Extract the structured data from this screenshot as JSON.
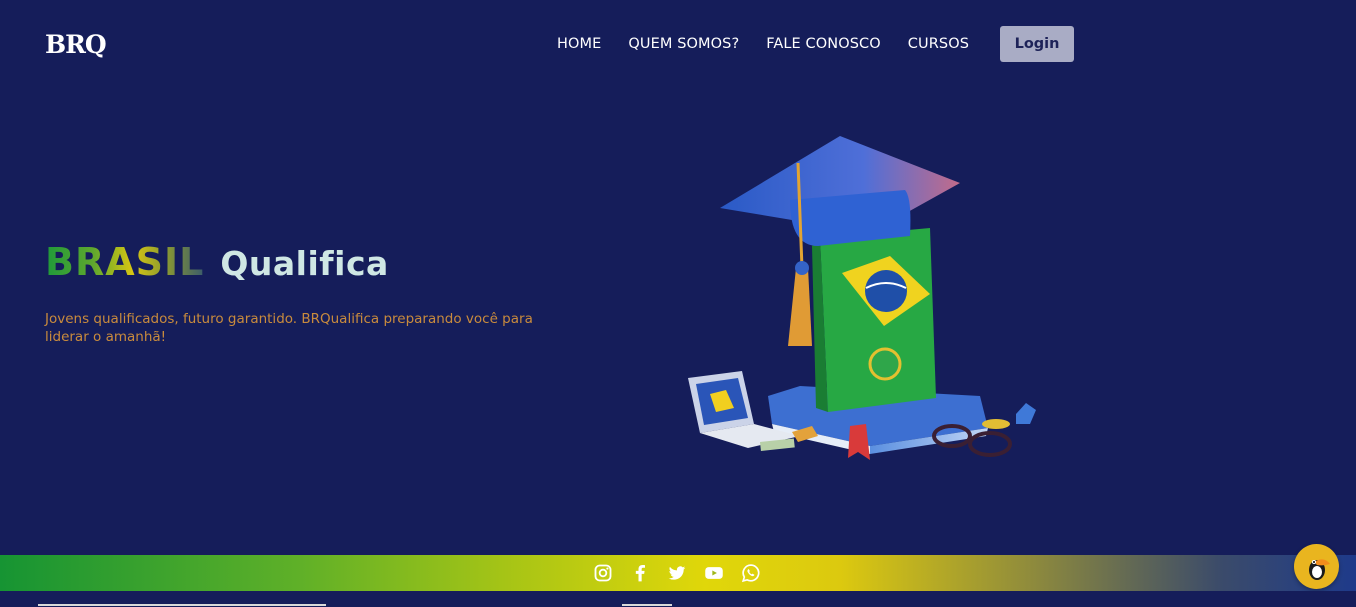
{
  "header": {
    "logo": "BRQ",
    "nav": [
      "HOME",
      "QUEM SOMOS?",
      "FALE CONOSCO",
      "CURSOS"
    ],
    "login_label": "Login"
  },
  "hero": {
    "title_part1": "BRASIL",
    "title_part2": "Qualifica",
    "subtitle": "Jovens qualificados, futuro garantido. BRQualifica preparando você para liderar o amanhã!"
  },
  "footer": {
    "social_icons": [
      "instagram-icon",
      "facebook-icon",
      "twitter-icon",
      "youtube-icon",
      "whatsapp-icon"
    ]
  },
  "colors": {
    "background": "#151d5a",
    "login_button": "#a9acc5",
    "subtitle": "#c98b3d",
    "qualifica": "#cfe7e4",
    "chat_bubble": "#e9b51f"
  }
}
